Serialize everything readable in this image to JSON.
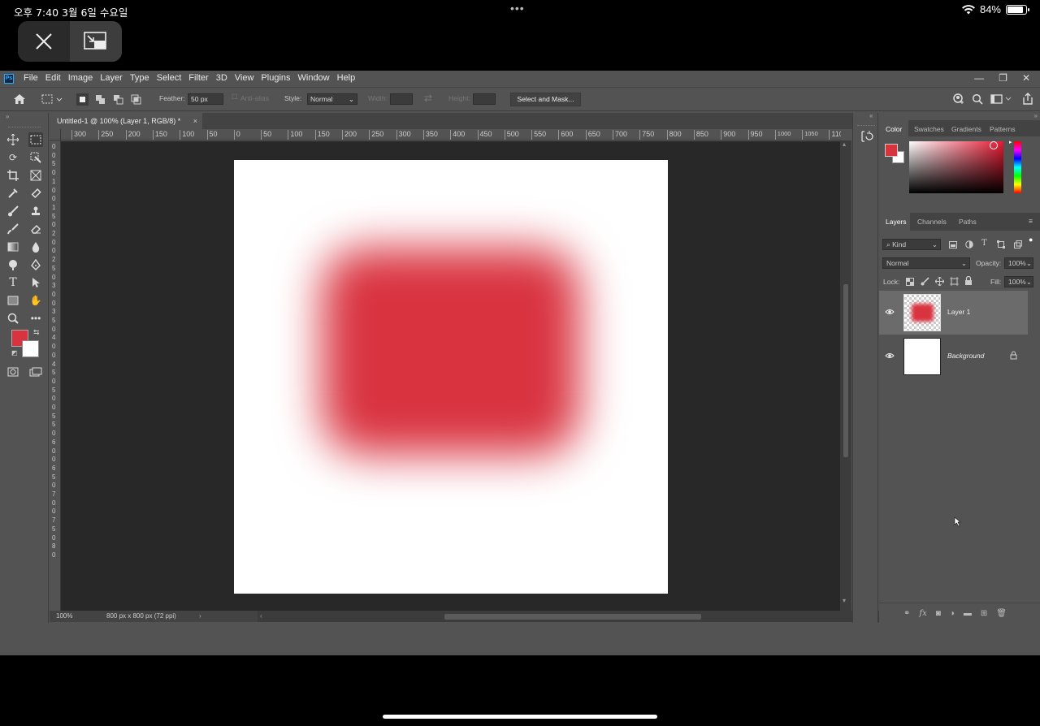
{
  "status_bar": {
    "time": "오후 7:40   3월 6일 수요일",
    "dots": "•••",
    "battery": "84%"
  },
  "app": {
    "logo": "Ps",
    "menus": [
      "File",
      "Edit",
      "Image",
      "Layer",
      "Type",
      "Select",
      "Filter",
      "3D",
      "View",
      "Plugins",
      "Window",
      "Help"
    ]
  },
  "options_bar": {
    "feather_label": "Feather:",
    "feather_value": "50 px",
    "anti_alias": "Anti-alias",
    "style_label": "Style:",
    "style_value": "Normal",
    "width_label": "Width:",
    "height_label": "Height:",
    "select_and_mask": "Select and Mask..."
  },
  "document": {
    "tab_title": "Untitled-1 @ 100% (Layer 1, RGB/8) *",
    "zoom": "100%",
    "doc_info": "800 px x 800 px (72 ppi)",
    "fill_color": "#d93340"
  },
  "rulers": {
    "horizontal": [
      "300",
      "250",
      "200",
      "150",
      "100",
      "50",
      "0",
      "50",
      "100",
      "150",
      "200",
      "250",
      "300",
      "350",
      "400",
      "450",
      "500",
      "550",
      "600",
      "650",
      "700",
      "750",
      "800",
      "850",
      "900",
      "950",
      "1000",
      "1050",
      "110"
    ],
    "vertical": [
      "0",
      "0",
      "5",
      "0",
      "1",
      "0",
      "0",
      "1",
      "5",
      "0",
      "2",
      "0",
      "0",
      "2",
      "5",
      "0",
      "3",
      "0",
      "0",
      "3",
      "5",
      "0",
      "4",
      "0",
      "0",
      "4",
      "5",
      "0",
      "5",
      "0",
      "0",
      "5",
      "5",
      "0",
      "6",
      "0",
      "0",
      "6",
      "5",
      "0",
      "7",
      "0",
      "0",
      "7",
      "5",
      "0",
      "8",
      "0"
    ]
  },
  "color_panel": {
    "tabs": [
      "Color",
      "Swatches",
      "Gradients",
      "Patterns"
    ],
    "foreground": "#d93340",
    "background": "#ffffff"
  },
  "layers_panel": {
    "tabs": [
      "Layers",
      "Channels",
      "Paths"
    ],
    "filter_kind": "Kind",
    "blend_mode": "Normal",
    "opacity_label": "Opacity:",
    "opacity_value": "100%",
    "lock_label": "Lock:",
    "fill_label": "Fill:",
    "fill_value": "100%",
    "layers": [
      {
        "name": "Layer 1",
        "selected": true
      },
      {
        "name": "Background",
        "locked": true
      }
    ]
  }
}
